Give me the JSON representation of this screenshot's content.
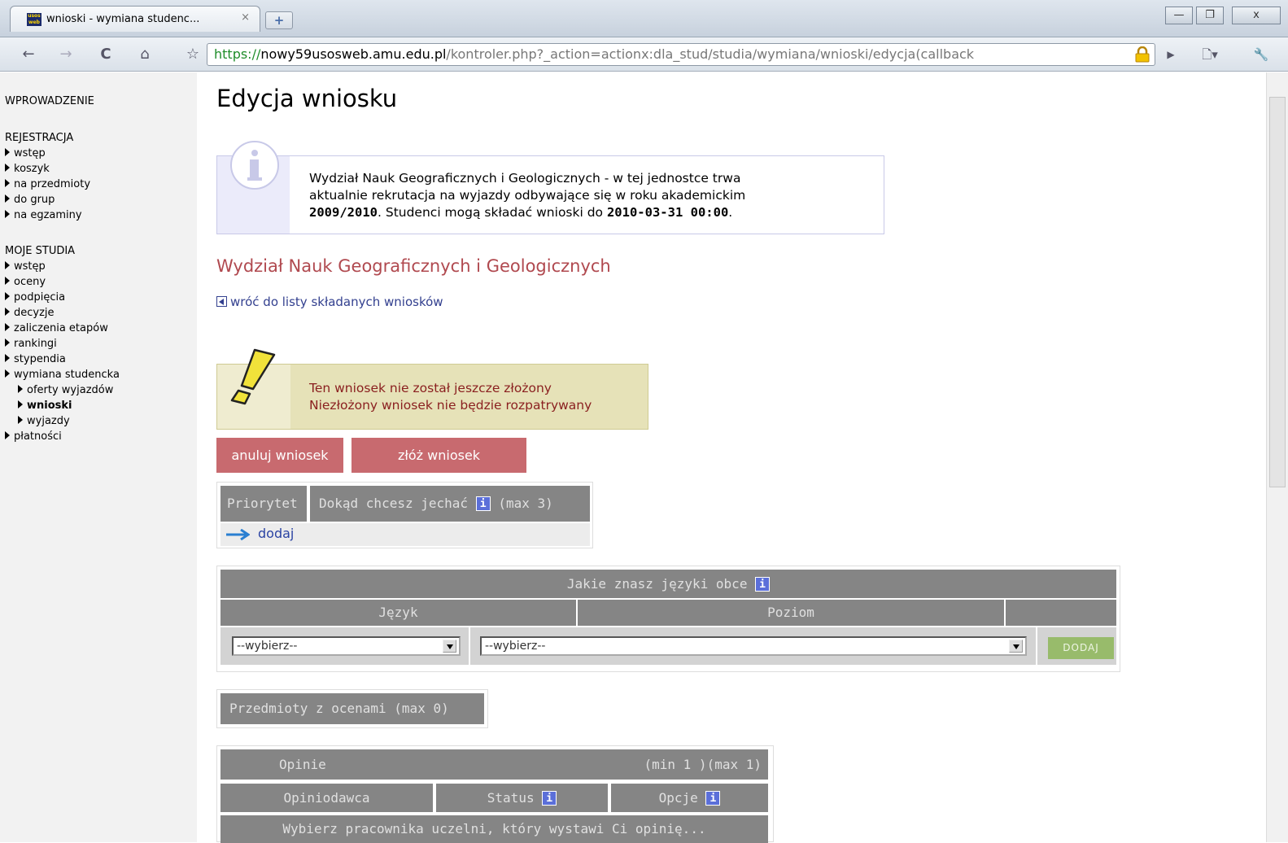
{
  "browser": {
    "tab_title": "wnioski - wymiana studenc...",
    "tab_close": "×",
    "new_tab": "+",
    "favicon_text": "usos web",
    "url_scheme": "https://",
    "url_host": "nowy59usosweb.amu.edu.pl",
    "url_path": "/kontroler.php?_action=actionx:dla_stud/studia/wymiana/wnioski/edycja(callback",
    "nav_back": "←",
    "nav_forward": "→",
    "nav_reload": "C",
    "nav_home": "⌂",
    "star": "☆",
    "win_min": "—",
    "win_max": "❐",
    "win_close": "x"
  },
  "sidebar": {
    "intro": "WPROWADZENIE",
    "reg_title": "REJESTRACJA",
    "reg_items": [
      "wstęp",
      "koszyk",
      "na przedmioty",
      "do grup",
      "na egzaminy"
    ],
    "study_title": "MOJE STUDIA",
    "study_items": [
      "wstęp",
      "oceny",
      "podpięcia",
      "decyzje",
      "zaliczenia etapów",
      "rankingi",
      "stypendia",
      "wymiana studencka"
    ],
    "exchange_items": [
      "oferty wyjazdów",
      "wnioski",
      "wyjazdy"
    ],
    "payments": "płatności"
  },
  "main": {
    "title": "Edycja wniosku",
    "info": {
      "line1": "Wydział Nauk Geograficznych i Geologicznych - w tej jednostce trwa",
      "line2": "aktualnie rekrutacja na wyjazdy odbywające się w roku akademickim",
      "year": "2009/2010",
      "mid": ". Studenci mogą składać wnioski do ",
      "deadline": "2010-03-31 00:00",
      "end": "."
    },
    "faculty": "Wydział Nauk Geograficznych i Geologicznych",
    "back_link": "wróć do listy składanych wniosków",
    "warning": {
      "line1": "Ten wniosek nie został jeszcze złożony",
      "line2": "Niezłożony wniosek nie będzie rozpatrywany"
    },
    "cancel_button": "anuluj wniosek",
    "submit_button": "złóż wniosek",
    "destinations": {
      "col_priority": "Priorytet",
      "col_where": "Dokąd chcesz jechać",
      "col_where_max": "(max 3)",
      "add": "dodaj"
    },
    "languages": {
      "caption": "Jakie znasz języki obce",
      "col_language": "Język",
      "col_level": "Poziom",
      "language_select": "--wybierz--",
      "level_select": "--wybierz--",
      "add_button": "DODAJ"
    },
    "grades": {
      "header": "Przedmioty z ocenami (max 0)"
    },
    "opinions": {
      "title": "Opinie",
      "limits": "(min 1 )(max 1)",
      "col_reviewer": "Opiniodawca",
      "col_status": "Status",
      "col_options": "Opcje",
      "select_row": "Wybierz pracownika uczelni, który wystawi Ci opinię..."
    },
    "info_badge": "i"
  }
}
